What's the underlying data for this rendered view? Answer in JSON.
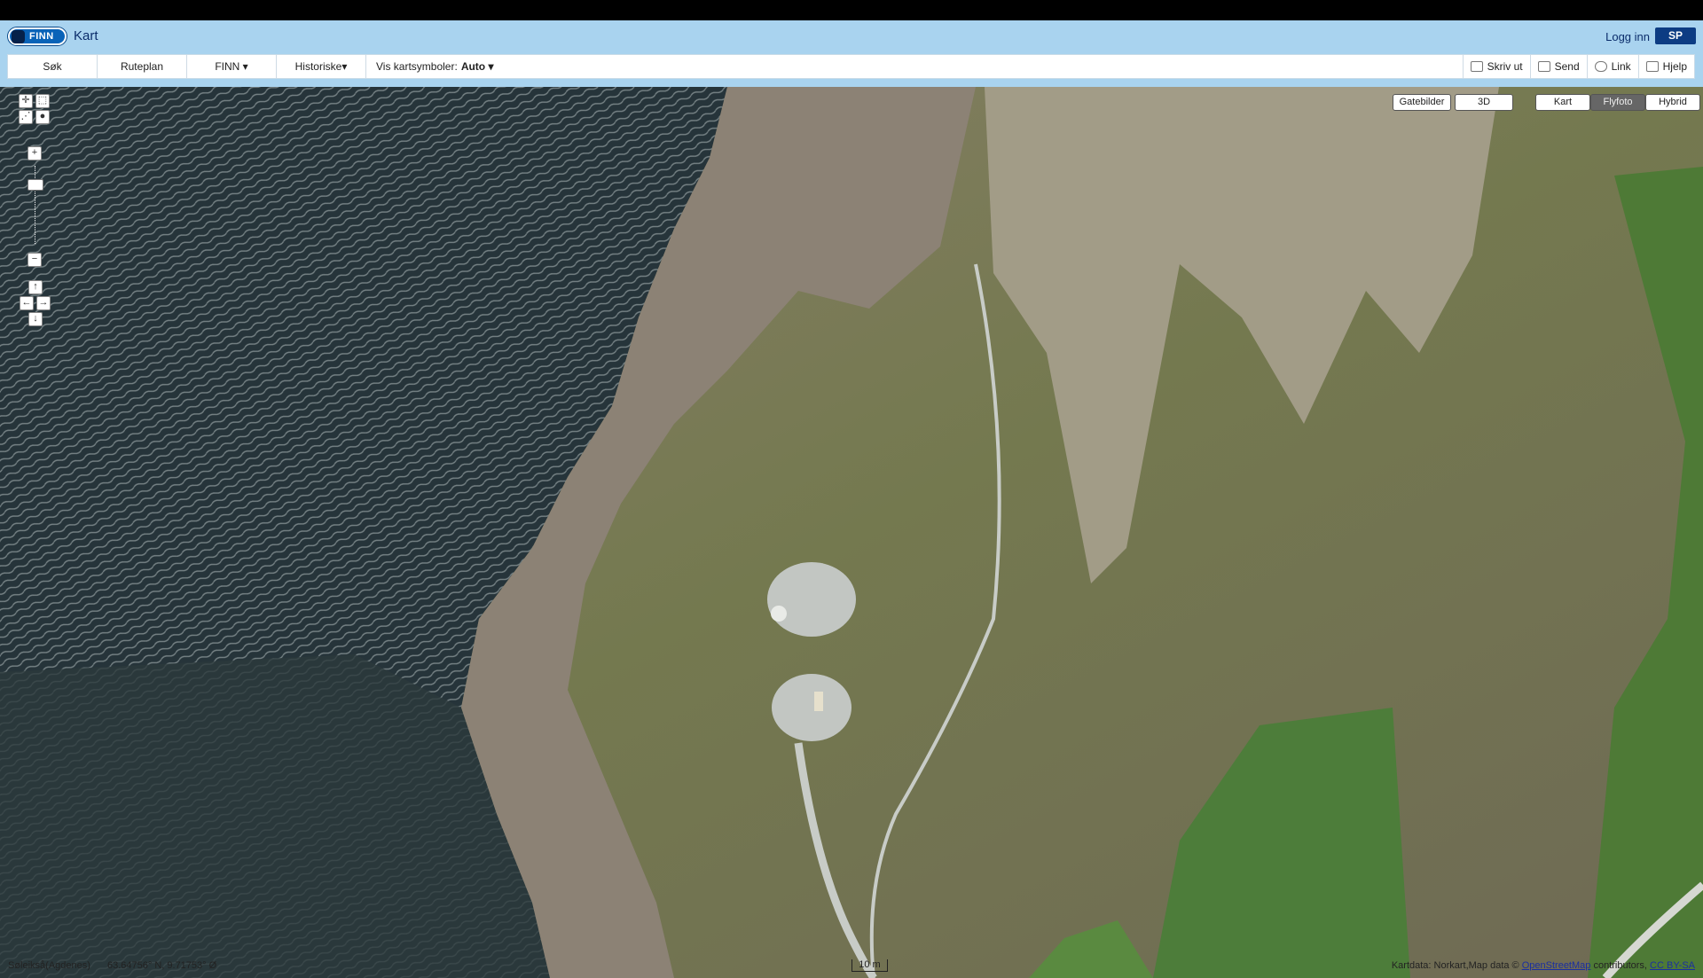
{
  "header": {
    "logo_text": "FINN",
    "title": "Kart",
    "login": "Logg inn",
    "badge": "SP"
  },
  "toolbar": {
    "items": [
      "Søk",
      "Ruteplan",
      "FINN ▾",
      "Historiske▾"
    ],
    "vis_label": "Vis kartsymboler:",
    "vis_value": "Auto ▾",
    "right": [
      {
        "label": "Skriv ut",
        "icon": "printer-icon"
      },
      {
        "label": "Send",
        "icon": "envelope-icon"
      },
      {
        "label": "Link",
        "icon": "link-icon"
      },
      {
        "label": "Hjelp",
        "icon": "help-icon"
      }
    ]
  },
  "map_controls": {
    "zoom_in": "+",
    "zoom_out": "−",
    "pan_up": "↑",
    "pan_left": "←",
    "pan_right": "→",
    "pan_down": "↓"
  },
  "layers": {
    "street": "Gatebilder",
    "three_d": "3D",
    "kart": "Kart",
    "flyfoto": "Flyfoto",
    "hybrid": "Hybrid",
    "active": "Flyfoto"
  },
  "status": {
    "place": "Søleikså(Agdenes)",
    "coords": "63.64756° N, 9.71753° Ø",
    "scale": "10 m",
    "attribution_prefix": "Kartdata: Norkart,Map data ©",
    "osm_link": "OpenStreetMap",
    "attribution_mid": "contributors,",
    "license_link": "CC BY-SA"
  },
  "colors": {
    "header_bg": "#a9d3ef",
    "water": "#26343a",
    "vegetation": "#6e7a4a",
    "rock": "#8e8070",
    "field": "#4d7d3a",
    "road": "#bfc3bd"
  }
}
